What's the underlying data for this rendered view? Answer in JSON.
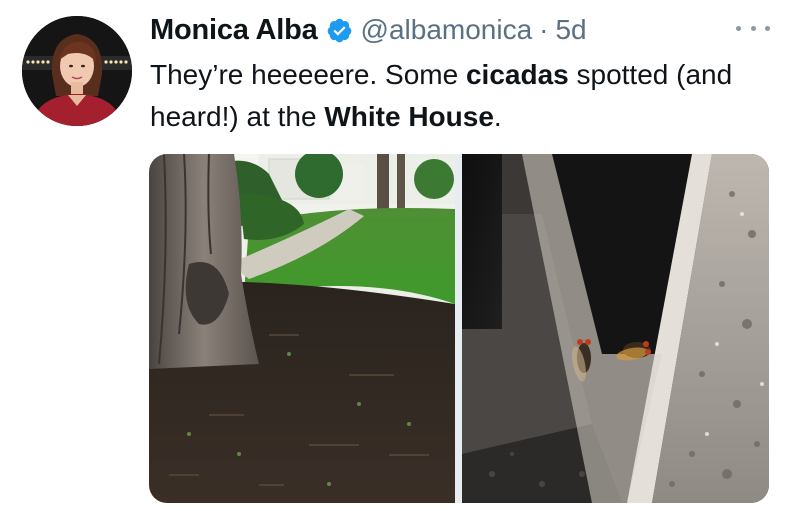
{
  "user": {
    "display_name": "Monica Alba",
    "handle": "@albamonica",
    "separator": "·",
    "timestamp": "5d",
    "verified_icon": "verified-badge-icon",
    "avatar_icon": "profile-photo"
  },
  "tweet": {
    "text_parts": {
      "p1": "They’re heeeeere. Some ",
      "b1": "cicadas",
      "p2": " spotted (and heard!) at the ",
      "b2": "White House",
      "p3": "."
    }
  },
  "media": {
    "photos": [
      {
        "name": "tree-lawn-photo"
      },
      {
        "name": "cicadas-on-stone-photo"
      }
    ]
  },
  "colors": {
    "verified": "#1d9bf0",
    "secondary_text": "#5b7083",
    "primary_text": "#0f1419"
  }
}
